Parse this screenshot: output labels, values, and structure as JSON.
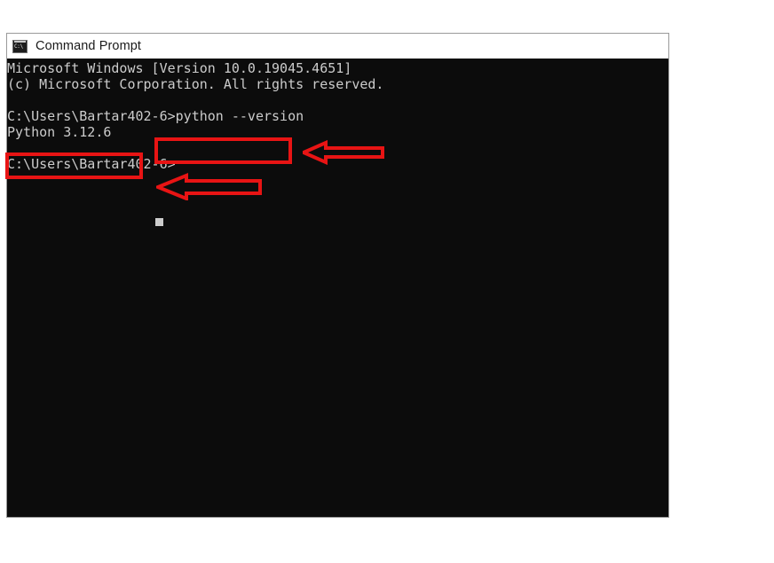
{
  "window": {
    "title": "Command Prompt",
    "icon": "command-prompt-icon",
    "icon_glyph": "C:\\",
    "background_color": "#0c0c0c",
    "text_color": "#cccccc",
    "titlebar_color": "#ffffff"
  },
  "console": {
    "lines": [
      "Microsoft Windows [Version 10.0.19045.4651]",
      "(c) Microsoft Corporation. All rights reserved.",
      "",
      "C:\\Users\\Bartar402-6>python --version",
      "Python 3.12.6",
      "",
      "C:\\Users\\Bartar402-6>"
    ],
    "full_text": "Microsoft Windows [Version 10.0.19045.4651]\n(c) Microsoft Corporation. All rights reserved.\n\nC:\\Users\\Bartar402-6>python --version\nPython 3.12.6\n\nC:\\Users\\Bartar402-6>",
    "os_version": "10.0.19045.4651",
    "copyright": "(c) Microsoft Corporation. All rights reserved.",
    "prompt": "C:\\Users\\Bartar402-6>",
    "command": "python --version",
    "command_output": "Python 3.12.6",
    "python_version": "3.12.6",
    "username": "Bartar402-6",
    "cursor": "block-caret"
  },
  "annotations": {
    "color": "#e81414",
    "highlight_command": {
      "name": "command-highlight-box",
      "target": "python --version"
    },
    "highlight_output": {
      "name": "output-highlight-box",
      "target": "Python 3.12.6"
    },
    "arrow_command": {
      "name": "arrow-pointing-to-command",
      "direction": "left"
    },
    "arrow_output": {
      "name": "arrow-pointing-to-prompt",
      "direction": "left"
    }
  }
}
